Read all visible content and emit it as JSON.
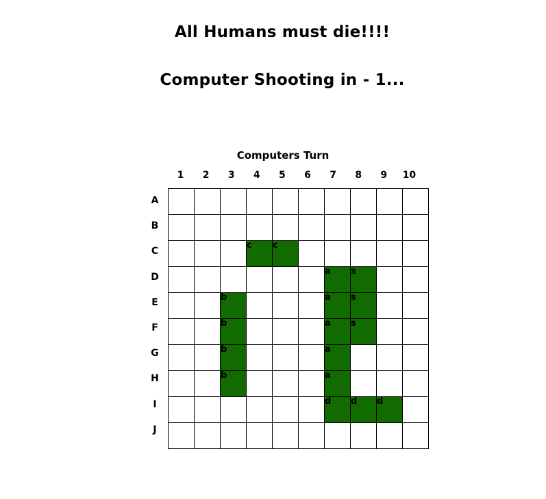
{
  "headings": {
    "taunt": "All Humans must die!!!!",
    "countdown": "Computer Shooting in - 1..."
  },
  "board": {
    "turn_label": "Computers Turn",
    "col_labels": [
      "1",
      "2",
      "3",
      "4",
      "5",
      "6",
      "7",
      "8",
      "9",
      "10"
    ],
    "row_labels": [
      "A",
      "B",
      "C",
      "D",
      "E",
      "F",
      "G",
      "H",
      "I",
      "J"
    ],
    "ship_color": "#126b00",
    "cells": {
      "C4": "c",
      "C5": "c",
      "D7": "a",
      "D8": "s",
      "E3": "b",
      "E7": "a",
      "E8": "s",
      "F3": "b",
      "F7": "a",
      "F8": "s",
      "G3": "b",
      "G7": "a",
      "H3": "b",
      "H7": "a",
      "I7": "d",
      "I8": "d",
      "I9": "d"
    }
  }
}
